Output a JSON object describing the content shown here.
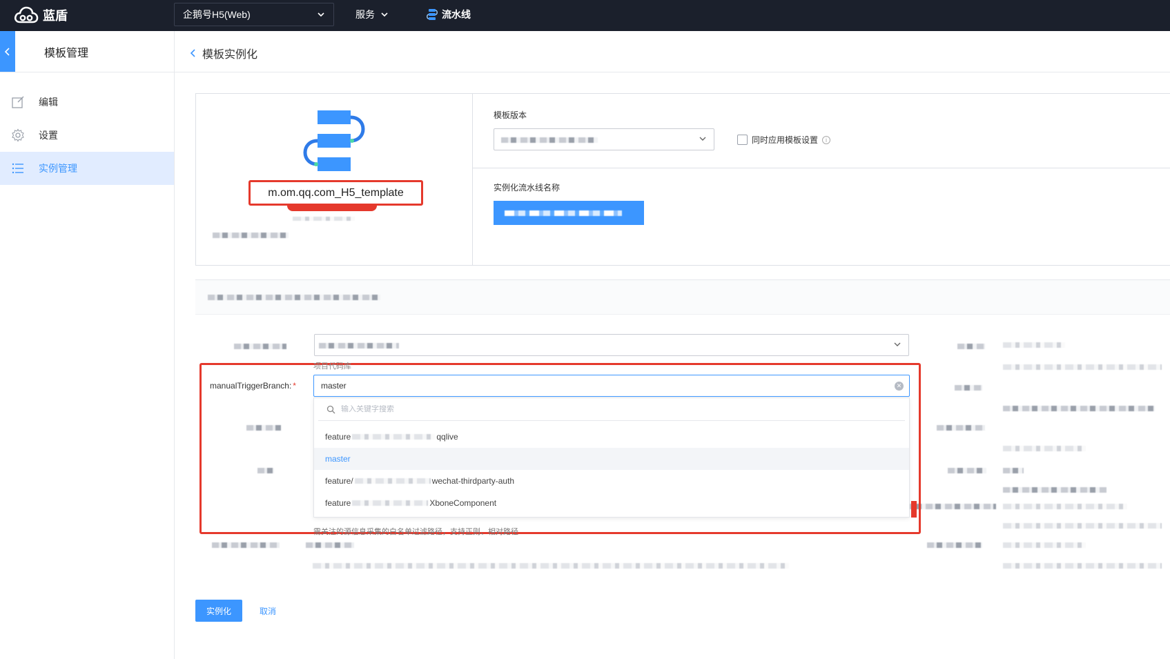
{
  "topbar": {
    "logo_text": "蓝盾",
    "project": "企鹅号H5(Web)",
    "services": "服务",
    "pipeline": "流水线"
  },
  "sidebar": {
    "title": "模板管理",
    "items": [
      {
        "label": "编辑",
        "icon": "edit-icon"
      },
      {
        "label": "设置",
        "icon": "gear-icon"
      },
      {
        "label": "实例管理",
        "icon": "list-icon",
        "active": true
      }
    ]
  },
  "header": {
    "back_label": "模板实例化"
  },
  "template": {
    "name": "m.om.qq.com_H5_template"
  },
  "form": {
    "version_label": "模板版本",
    "sync_settings_label": "同时应用模板设置",
    "instance_name_label": "实例化流水线名称"
  },
  "params": {
    "repo_hint": "项目代码库",
    "branch_label": "manualTriggerBranch:",
    "branch_required": "*",
    "branch_value": "master",
    "search_placeholder": "输入关键字搜索",
    "options": [
      {
        "prefix": "feature",
        "suffix": "qqlive",
        "selected": false
      },
      {
        "prefix": "master",
        "suffix": "",
        "selected": true
      },
      {
        "prefix": "feature/",
        "suffix": "wechat-thirdparty-auth",
        "selected": false
      },
      {
        "prefix": "feature",
        "suffix": "XboneComponent",
        "selected": false
      }
    ],
    "path_hint": "需关注的源信息采集的白名单过滤路径，支持正则、相对路径"
  },
  "actions": {
    "instantiate": "实例化",
    "cancel": "取消"
  },
  "colors": {
    "accent": "#3c96ff",
    "topbar": "#1b202c",
    "annotation_red": "#e5392c"
  }
}
